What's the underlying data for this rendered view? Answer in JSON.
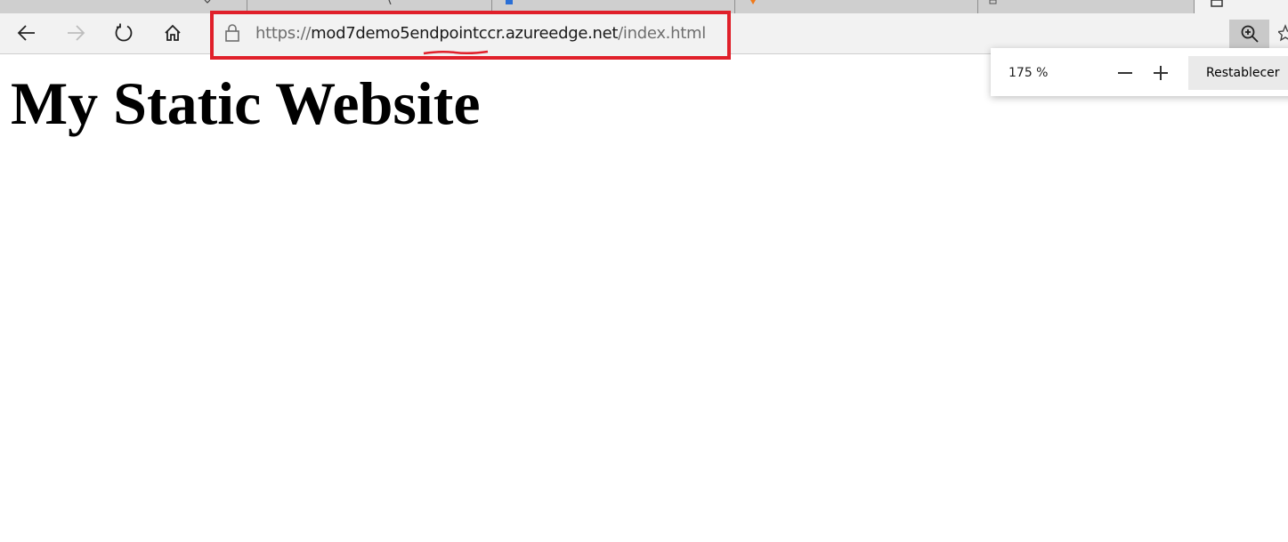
{
  "browser": {
    "address_bar": {
      "scheme": "https://",
      "domain": "mod7demo5endpointccr.azureedge.net",
      "path": "/index.html"
    },
    "zoom_popup": {
      "level": "175 %",
      "reset_label": "Restablecer"
    },
    "colors": {
      "highlight_red": "#e0202a",
      "toolbar_bg": "#f2f2f2"
    }
  },
  "page": {
    "title": "My Static Website"
  }
}
